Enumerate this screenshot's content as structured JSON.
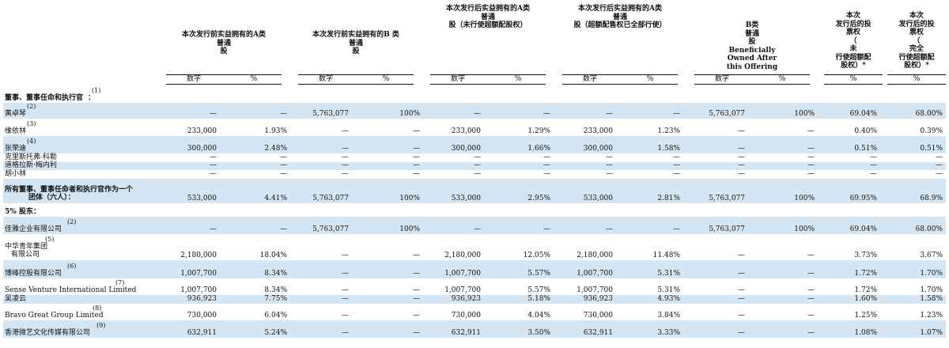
{
  "headers": {
    "pre_a": [
      "本次发行前实益拥有的A类",
      "普通",
      "股"
    ],
    "pre_b": [
      "本次发行前实益拥有的B 类",
      "普通",
      "股"
    ],
    "post_a_no": [
      "本次发行后实益拥有的A类",
      "普通",
      "股（未行使超额配股权）"
    ],
    "post_a_full": [
      "本次发行后实益拥有的A类",
      "普通",
      "股（超额配售权已全部行使）"
    ],
    "post_b": [
      "B类",
      "普通",
      "股",
      "Beneficially",
      "Owned After",
      "this Offering"
    ],
    "vote_no": [
      "本次",
      "发行后的投",
      "票权",
      "（",
      "未",
      "行使超额配",
      "股权）*"
    ],
    "vote_full": [
      "本次",
      "发行后的投",
      "票权",
      "（",
      "完全",
      "行使超额配",
      "股权）*"
    ],
    "number": "数字",
    "pct": "%"
  },
  "rows": [
    {
      "label": "董事、董事任命和执行官",
      "suffix": "：",
      "note": "(1)",
      "bold": true,
      "shade": false,
      "cells": []
    },
    {
      "label": "黄卓琴",
      "note": "(2)",
      "shade": true,
      "cells": [
        "—",
        "—",
        "5,763,077",
        "100%",
        "—",
        "—",
        "—",
        "—",
        "5,763,077",
        "100%",
        "69.04%",
        "68.00%"
      ]
    },
    {
      "label": "维依林",
      "note": "(3)",
      "shade": false,
      "cells": [
        "233,000",
        "1.93%",
        "—",
        "—",
        "233,000",
        "1.29%",
        "233,000",
        "1.23%",
        "—",
        "—",
        "0.40%",
        "0.39%"
      ]
    },
    {
      "label": "张荣迪",
      "note": "(4)",
      "shade": true,
      "cells": [
        "300,000",
        "2.48%",
        "—",
        "—",
        "300,000",
        "1.66%",
        "300,000",
        "1.58%",
        "—",
        "—",
        "0.51%",
        "0.51%"
      ]
    },
    {
      "label": "克里斯托弗·科勒",
      "shade": false,
      "cells": [
        "—",
        "—",
        "—",
        "—",
        "—",
        "—",
        "—",
        "—",
        "—",
        "—",
        "—",
        "—"
      ]
    },
    {
      "label": "道格拉斯·梅内利",
      "shade": true,
      "cells": [
        "—",
        "—",
        "—",
        "—",
        "—",
        "—",
        "—",
        "—",
        "—",
        "—",
        "—",
        "—"
      ]
    },
    {
      "label": "胡小林",
      "shade": false,
      "cells": [
        "—",
        "—",
        "—",
        "—",
        "—",
        "—",
        "—",
        "—",
        "—",
        "—",
        "—",
        "—"
      ]
    },
    {
      "label": "所有董事、董事任命者和执行官作为一个",
      "label2": "团体（六人）：",
      "bold": true,
      "shade": true,
      "cells": [
        "533,000",
        "4.41%",
        "5,763,077",
        "100%",
        "533,000",
        "2.95%",
        "533,000",
        "2.81%",
        "5,763,077",
        "100%",
        "69.95%",
        "68.9%"
      ]
    },
    {
      "label": "5% 股东：",
      "bold": true,
      "shade": false,
      "cells": []
    },
    {
      "label": "佳雅企业有限公司",
      "note": "(2)",
      "shade": true,
      "cells": [
        "—",
        "—",
        "5,763,077",
        "100%",
        "—",
        "—",
        "—",
        "—",
        "5,763,077",
        "100%",
        "69.04%",
        "68.00%"
      ]
    },
    {
      "label": "中华青年集团",
      "label2": "有限公司",
      "note": "(5)",
      "shade": false,
      "cells": [
        "2,180,000",
        "18.04%",
        "—",
        "—",
        "2,180,000",
        "12.05%",
        "2,180,000",
        "11.48%",
        "—",
        "—",
        "3.73%",
        "3.67%"
      ]
    },
    {
      "label": "博峰控股有限公司",
      "note": "(6)",
      "shade": true,
      "cells": [
        "1,007,700",
        "8.34%",
        "—",
        "—",
        "1,007,700",
        "5.57%",
        "1,007,700",
        "5.31%",
        "—",
        "—",
        "1.72%",
        "1.70%"
      ]
    },
    {
      "label": "Sense Venture International Limited",
      "note": "(7)",
      "shade": false,
      "cells": [
        "1,007,700",
        "8.34%",
        "—",
        "—",
        "1,007,700",
        "5.57%",
        "1,007,700",
        "5.31%",
        "—",
        "—",
        "1.72%",
        "1.70%"
      ]
    },
    {
      "label": "吴凌云",
      "shade": true,
      "cells": [
        "936,923",
        "7.75%",
        "—",
        "—",
        "936,923",
        "5.18%",
        "936,923",
        "4.93%",
        "—",
        "—",
        "1.60%",
        "1.58%"
      ]
    },
    {
      "label": "Bravo Great Group Limited",
      "note": "(8)",
      "shade": false,
      "cells": [
        "730,000",
        "6.04%",
        "—",
        "—",
        "730,000",
        "4.04%",
        "730,000",
        "3.84%",
        "—",
        "—",
        "1.25%",
        "1.23%"
      ]
    },
    {
      "label": "香港微艺文化传媒有限公司",
      "note": "(9)",
      "shade": true,
      "cells": [
        "632,911",
        "5.24%",
        "—",
        "—",
        "632,911",
        "3.50%",
        "632,911",
        "3.33%",
        "—",
        "—",
        "1.08%",
        "1.07%"
      ]
    }
  ]
}
